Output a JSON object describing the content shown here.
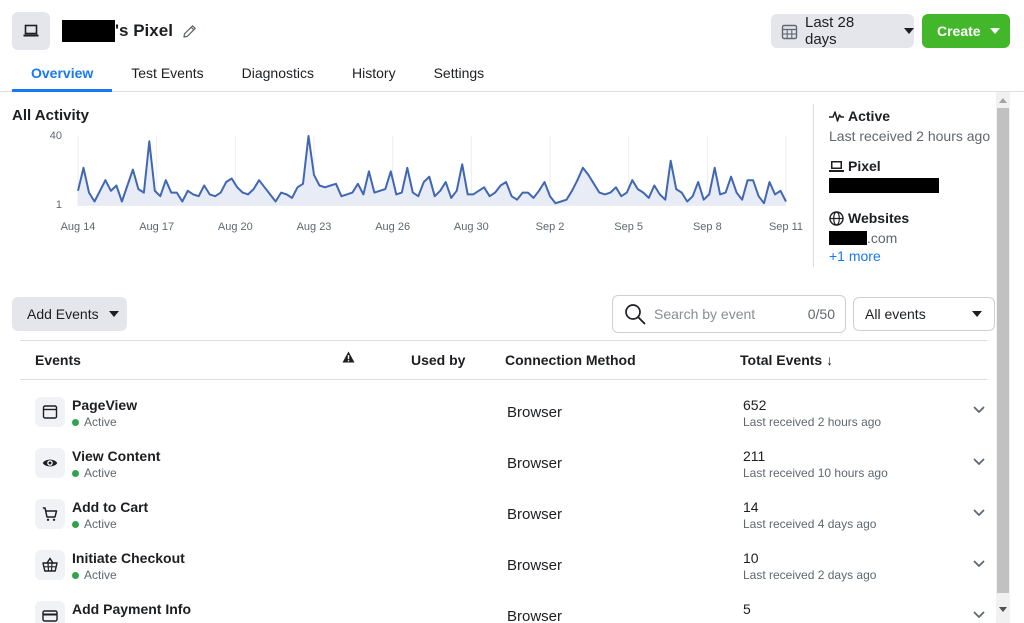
{
  "header": {
    "title_suffix": "'s Pixel",
    "date_range": "Last 28 days",
    "create_label": "Create"
  },
  "tabs": [
    {
      "label": "Overview",
      "active": true
    },
    {
      "label": "Test Events",
      "active": false
    },
    {
      "label": "Diagnostics",
      "active": false
    },
    {
      "label": "History",
      "active": false
    },
    {
      "label": "Settings",
      "active": false
    }
  ],
  "activity": {
    "title": "All Activity"
  },
  "chart_data": {
    "type": "area",
    "title": "All Activity",
    "y_ticks": [
      "40",
      "1"
    ],
    "ylim": [
      1,
      40
    ],
    "x_ticks": [
      "Aug 14",
      "Aug 17",
      "Aug 20",
      "Aug 23",
      "Aug 26",
      "Aug 30",
      "Sep 2",
      "Sep 5",
      "Sep 8",
      "Sep 11"
    ],
    "series": [
      {
        "color": "#4267b2",
        "values": [
          9,
          22,
          8,
          3,
          9,
          15,
          9,
          12,
          3,
          12,
          21,
          10,
          8,
          37,
          9,
          6,
          15,
          8,
          8,
          3,
          9,
          7,
          6,
          12,
          7,
          6,
          8,
          14,
          16,
          11,
          8,
          7,
          10,
          15,
          11,
          7,
          3,
          8,
          7,
          5,
          11,
          13,
          40,
          18,
          12,
          11,
          12,
          13,
          6,
          7,
          8,
          13,
          7,
          20,
          8,
          9,
          10,
          20,
          7,
          8,
          22,
          8,
          6,
          14,
          17,
          6,
          9,
          14,
          5,
          9,
          24,
          7,
          7,
          9,
          11,
          6,
          8,
          12,
          14,
          6,
          4,
          8,
          8,
          5,
          9,
          14,
          6,
          2,
          3,
          4,
          9,
          15,
          22,
          18,
          13,
          8,
          7,
          8,
          11,
          6,
          8,
          15,
          10,
          8,
          5,
          12,
          7,
          4,
          26,
          10,
          8,
          3,
          6,
          14,
          4,
          7,
          22,
          7,
          8,
          17,
          8,
          4,
          15,
          15,
          6,
          2,
          14,
          7,
          9,
          3
        ]
      }
    ]
  },
  "status": {
    "active_label": "Active",
    "active_sub": "Last received 2 hours ago",
    "pixel_label": "Pixel",
    "websites_label": "Websites",
    "website_domain": ".com",
    "more_link": "+1 more"
  },
  "toolbar": {
    "add_events": "Add Events",
    "search_placeholder": "Search by event",
    "search_count": "0/50",
    "filter_value": "All events"
  },
  "table": {
    "columns": {
      "events": "Events",
      "used_by": "Used by",
      "connection": "Connection Method",
      "total": "Total Events ↓"
    },
    "rows": [
      {
        "icon": "browser-window-icon",
        "name": "PageView",
        "status": "Active",
        "connection": "Browser",
        "total": "652",
        "last": "Last received 2 hours ago"
      },
      {
        "icon": "eye-icon",
        "name": "View Content",
        "status": "Active",
        "connection": "Browser",
        "total": "211",
        "last": "Last received 10 hours ago"
      },
      {
        "icon": "cart-icon",
        "name": "Add to Cart",
        "status": "Active",
        "connection": "Browser",
        "total": "14",
        "last": "Last received 4 days ago"
      },
      {
        "icon": "basket-icon",
        "name": "Initiate Checkout",
        "status": "Active",
        "connection": "Browser",
        "total": "10",
        "last": "Last received 2 days ago"
      },
      {
        "icon": "card-icon",
        "name": "Add Payment Info",
        "status": "",
        "connection": "Browser",
        "total": "5",
        "last": ""
      }
    ]
  }
}
